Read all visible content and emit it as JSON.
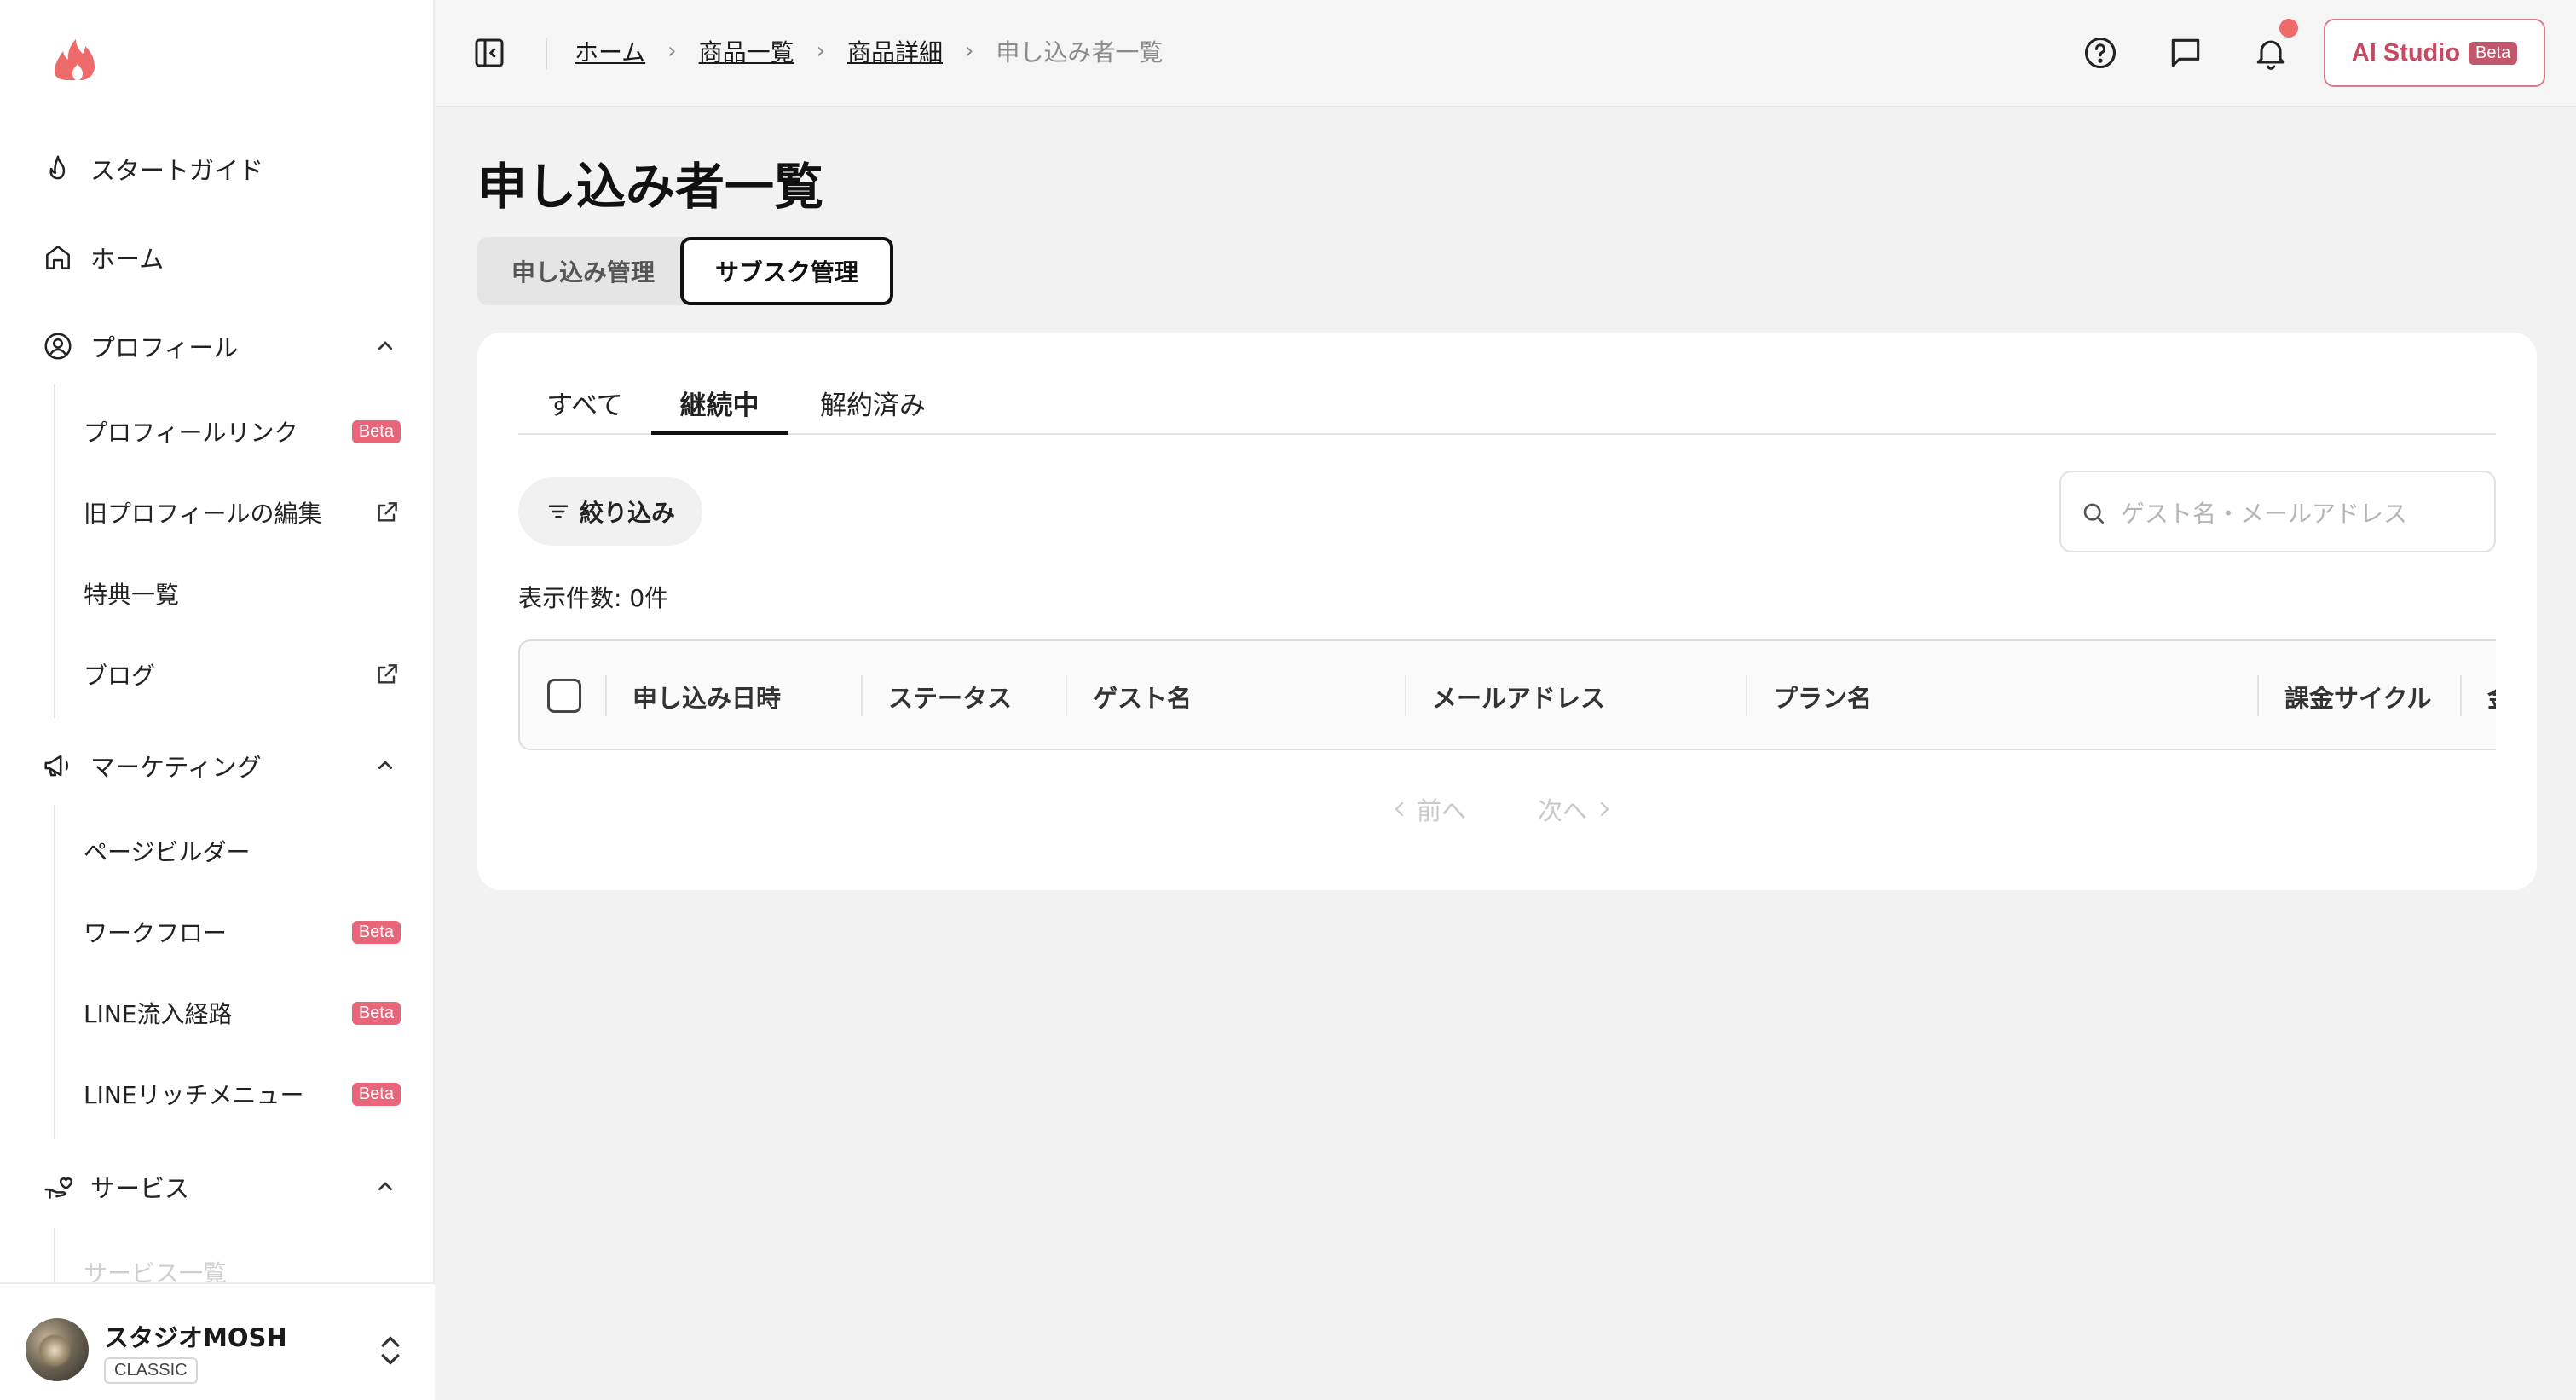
{
  "sidebar": {
    "items": [
      {
        "label": "スタートガイド"
      },
      {
        "label": "ホーム"
      },
      {
        "label": "プロフィール"
      },
      {
        "label": "マーケティング"
      },
      {
        "label": "サービス"
      }
    ],
    "profile_sub": [
      {
        "label": "プロフィールリンク",
        "badge": "Beta"
      },
      {
        "label": "旧プロフィールの編集"
      },
      {
        "label": "特典一覧"
      },
      {
        "label": "ブログ"
      }
    ],
    "marketing_sub": [
      {
        "label": "ページビルダー"
      },
      {
        "label": "ワークフロー",
        "badge": "Beta"
      },
      {
        "label": "LINE流入経路",
        "badge": "Beta"
      },
      {
        "label": "LINEリッチメニュー",
        "badge": "Beta"
      }
    ],
    "service_sub": [
      {
        "label": "サービス一覧"
      }
    ],
    "account": {
      "name": "スタジオMOSH",
      "plan": "CLASSIC"
    }
  },
  "header": {
    "breadcrumb": [
      "ホーム",
      "商品一覧",
      "商品詳細"
    ],
    "breadcrumb_current": "申し込み者一覧",
    "ai_button": {
      "label": "AI Studio",
      "badge": "Beta"
    }
  },
  "main": {
    "title": "申し込み者一覧",
    "segments": [
      "申し込み管理",
      "サブスク管理"
    ],
    "active_segment": "サブスク管理",
    "tabs": [
      "すべて",
      "継続中",
      "解約済み"
    ],
    "active_tab": "継続中",
    "filter_label": "絞り込み",
    "search_placeholder": "ゲスト名・メールアドレス",
    "count_label": "表示件数: 0件",
    "columns": [
      "申し込み日時",
      "ステータス",
      "ゲスト名",
      "メールアドレス",
      "プラン名",
      "課金サイクル",
      "金"
    ],
    "pager": {
      "prev": "前へ",
      "next": "次へ"
    }
  },
  "colors": {
    "accent": "#e8657a",
    "ai_text": "#c94862",
    "notif_dot": "#ef6b6b"
  }
}
